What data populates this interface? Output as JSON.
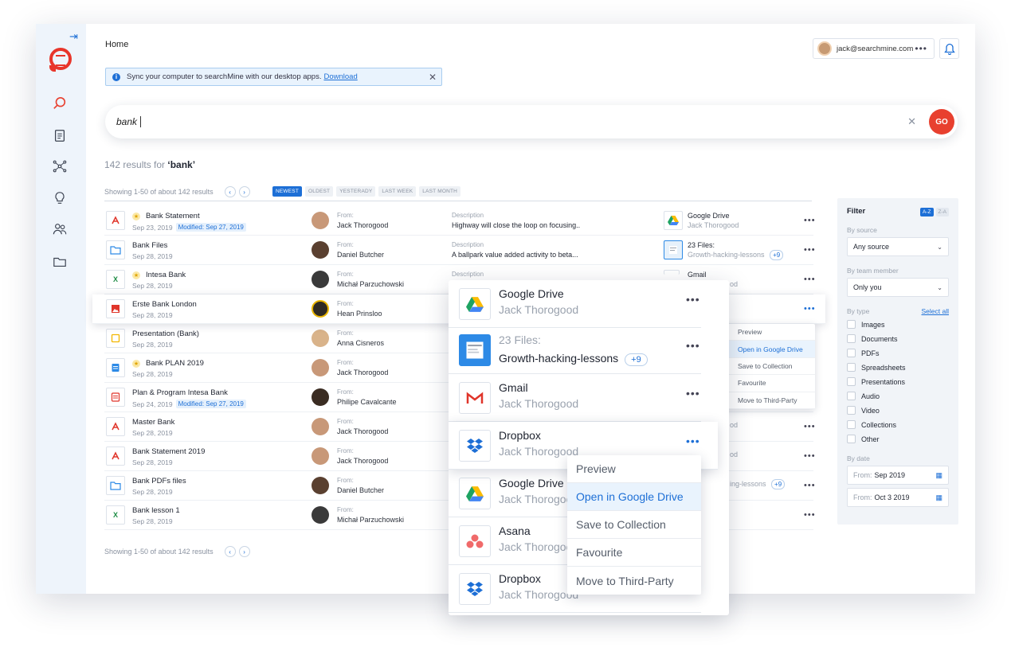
{
  "header": {
    "breadcrumb": "Home",
    "user_email": "jack@searchmine.com",
    "menu_dots": "•••"
  },
  "notice": {
    "text": "Sync your computer to searchMine with our desktop apps.",
    "link": "Download",
    "info": "i",
    "close": "✕"
  },
  "search": {
    "query": "bank",
    "clear": "✕",
    "go_label": "GO"
  },
  "results": {
    "count_prefix": "142 results for",
    "count_query": "‘bank’",
    "showing": "Showing 1-50 of about 142 results",
    "prev": "‹",
    "next": "›",
    "sort_chips": [
      "NEWEST",
      "OLDEST",
      "YESTERADY",
      "LAST WEEK",
      "LAST MONTH"
    ]
  },
  "rows": [
    {
      "name": "Bank Statement",
      "star": true,
      "date": "Sep 23, 2019",
      "modified": "Modified: Sep 27, 2019",
      "from_label": "From:",
      "from": "Jack Thorogood",
      "desc_label": "Description",
      "desc": "Highway will close the loop on focusing..",
      "source": "Google Drive",
      "source_sub": "Jack Thorogood",
      "icon": "pdf"
    },
    {
      "name": "Bank Files",
      "star": false,
      "date": "Sep 28, 2019",
      "modified": "",
      "from_label": "From:",
      "from": "Daniel Butcher",
      "desc_label": "Description",
      "desc": "A ballpark value added activity to beta...",
      "source": "23 Files:",
      "source_sub": "Growth-hacking-lessons",
      "source_badge": "+9",
      "icon": "folder"
    },
    {
      "name": "Intesa Bank",
      "star": true,
      "date": "Sep 28, 2019",
      "modified": "",
      "from_label": "From:",
      "from": "Michał Parzuchowski",
      "desc_label": "Description",
      "desc": "",
      "source": "Gmail",
      "source_sub": "od",
      "icon": "xls"
    },
    {
      "name": "Erste Bank London",
      "star": false,
      "date": "Sep 28, 2019",
      "modified": "",
      "from_label": "From:",
      "from": "Hean Prinsloo",
      "desc_label": "",
      "desc": "",
      "source": "",
      "source_sub": "",
      "icon": "img"
    },
    {
      "name": "Presentation (Bank)",
      "star": false,
      "date": "Sep 28, 2019",
      "modified": "",
      "from_label": "From:",
      "from": "Anna Cisneros",
      "icon": "ppt"
    },
    {
      "name": "Bank PLAN 2019",
      "star": true,
      "date": "Sep 28, 2019",
      "modified": "",
      "from_label": "From:",
      "from": "Jack Thorogood",
      "icon": "doc"
    },
    {
      "name": "Plan & Program Intesa Bank",
      "star": false,
      "date": "Sep 24, 2019",
      "modified": "Modified: Sep 27, 2019",
      "from_label": "From:",
      "from": "Philipe Cavalcante",
      "icon": "txt"
    },
    {
      "name": "Master Bank",
      "star": false,
      "date": "Sep 28, 2019",
      "modified": "",
      "from_label": "From:",
      "from": "Jack Thorogood",
      "partial": "od",
      "icon": "pdf"
    },
    {
      "name": "Bank Statement 2019",
      "star": false,
      "date": "Sep 28, 2019",
      "modified": "",
      "from_label": "From:",
      "from": "Jack Thorogood",
      "partial": "od",
      "icon": "pdf"
    },
    {
      "name": "Bank PDFs files",
      "star": false,
      "date": "Sep 28, 2019",
      "modified": "",
      "from_label": "From:",
      "from": "Daniel Butcher",
      "partial": "ing-lessons",
      "partial_badge": "+9",
      "icon": "folder"
    },
    {
      "name": "Bank lesson 1",
      "star": false,
      "date": "Sep 28, 2019",
      "modified": "",
      "from_label": "From:",
      "from": "Michał Parzuchowski",
      "icon": "xls"
    }
  ],
  "filter": {
    "title": "Filter",
    "az": "A-Z",
    "za": "Z-A",
    "by_source": "By source",
    "source_value": "Any source",
    "by_team": "By team member",
    "team_value": "Only you",
    "by_type": "By type",
    "select_all": "Select all",
    "types": [
      "Images",
      "Documents",
      "PDFs",
      "Spreadsheets",
      "Presentations",
      "Audio",
      "Video",
      "Collections",
      "Other"
    ],
    "by_date": "By date",
    "from_label": "From:",
    "from_date": "Sep 2019",
    "to_label": "From:",
    "to_date": "Oct 3 2019"
  },
  "small_menu": [
    "Preview",
    "Open in Google Drive",
    "Save to Collection",
    "Favourite",
    "Move to Third-Party"
  ],
  "overlay": [
    {
      "title": "Google Drive",
      "sub": "Jack Thorogood",
      "icon": "gdrive"
    },
    {
      "title": "23 Files:",
      "sub": "Growth-hacking-lessons",
      "badge": "+9",
      "icon": "thumb"
    },
    {
      "title": "Gmail",
      "sub": "Jack Thorogood",
      "icon": "gmail"
    },
    {
      "title": "Dropbox",
      "sub": "Jack Thorogood",
      "icon": "dropbox"
    },
    {
      "title": "Google Drive",
      "sub": "Jack Thorogood",
      "icon": "gdrive"
    },
    {
      "title": "Asana",
      "sub": "Jack Thorogood",
      "icon": "asana"
    },
    {
      "title": "Dropbox",
      "sub": "Jack Thorogood",
      "icon": "dropbox"
    }
  ],
  "big_menu": [
    "Preview",
    "Open in Google Drive",
    "Save to Collection",
    "Favourite",
    "Move to Third-Party"
  ],
  "colors": {
    "accent": "#1d6fd6",
    "brand_red": "#e8402f",
    "sidebar_bg": "#eef4fb"
  }
}
